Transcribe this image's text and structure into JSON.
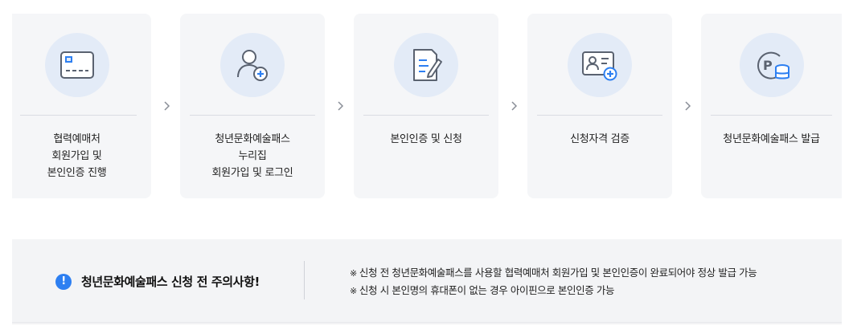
{
  "steps": [
    {
      "label": "협력예매처\n회원가입 및\n본인인증 진행",
      "icon": "card-icon"
    },
    {
      "label": "청년문화예술패스\n누리집\n회원가입 및 로그인",
      "icon": "user-add-icon"
    },
    {
      "label": "본인인증 및 신청",
      "icon": "document-edit-icon"
    },
    {
      "label": "신청자격 검증",
      "icon": "id-card-add-icon"
    },
    {
      "label": "청년문화예술패스 발급",
      "icon": "points-coin-icon"
    }
  ],
  "colors": {
    "accent": "#2d7ff1",
    "icon_stroke": "#5a6270",
    "icon_bg": "#e3ebf7",
    "card_bg": "#f5f6f8"
  },
  "notice": {
    "title": "청년문화예술패스 신청 전 주의사항!",
    "icon_glyph": "!",
    "items": [
      "신청 전 청년문화예술패스를 사용할 협력예매처 회원가입 및 본인인증이 완료되어야 정상 발급 가능",
      "신청 시 본인명의 휴대폰이 없는 경우 아이핀으로 본인인증 가능"
    ]
  }
}
